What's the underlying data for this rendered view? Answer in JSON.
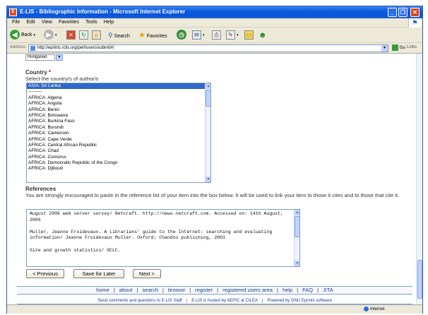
{
  "window": {
    "title": "E-LIS - Bibliographic Information - Microsoft Internet Explorer",
    "app_icon_letter": "E"
  },
  "menu": [
    "File",
    "Edit",
    "View",
    "Favorites",
    "Tools",
    "Help"
  ],
  "toolbar": {
    "back": "Back",
    "search": "Search",
    "favorites": "Favorites"
  },
  "address": {
    "label": "Address",
    "url": "http://eprints.rclis.org/perl/users/submit#t",
    "go": "Go",
    "links": "Links"
  },
  "status": {
    "left": "",
    "zone": "Internet"
  },
  "form": {
    "language_value": "Hungarian",
    "country": {
      "label": "Country",
      "required_mark": "*",
      "help": "Select the country/s of author/s",
      "options": [
        "ASIA: Sri Lanka",
        "---------",
        "AFRICA: Algeria",
        "AFRICA: Angola",
        "AFRICA: Benin",
        "AFRICA: Botswana",
        "AFRICA: Burkina Faso",
        "AFRICA: Burundi",
        "AFRICA: Cameroon",
        "AFRICA: Cape Verde",
        "AFRICA: Central African Republic",
        "AFRICA: Chad",
        "AFRICA: Comoros",
        "AFRICA: Democratic Republic of the Congo",
        "AFRICA: Djibouti"
      ],
      "selected_index": 0
    },
    "references": {
      "label": "References",
      "help": "You are strongly encouraged to paste in the reference list of your item into the box below. It will be used to link your item to those it cites and to those that cite it.",
      "value": "August 2006 web server survey/ Netcraft. http://news.netcraft.com. Accessed on: 14th August, 2006\n\nMuller, Jeanne Froidevaux. A Librarians' guide to the Internet: searching and evaluating information/ Jeanne Froidevaux Muller. Oxford: Chandos publishing, 2003\n\nSize and growth statistics/ OCLC."
    },
    "buttons": {
      "previous": "< Previous",
      "save": "Save for Later",
      "next": "Next >"
    }
  },
  "nav": [
    "home",
    "about",
    "search",
    "browse",
    "register",
    "registered users area",
    "help",
    "FAQ",
    "JITA"
  ],
  "footer": [
    "Send comments and questions to E-LIS Staff",
    "E-LIS is hosted by AEPIC at CILEA",
    "Powered by GNU Eprints software"
  ],
  "colors": {
    "titlebar": "#0a5ae0",
    "selection": "#316ac5",
    "link": "#1a3e8c",
    "required": "#cc0000"
  }
}
